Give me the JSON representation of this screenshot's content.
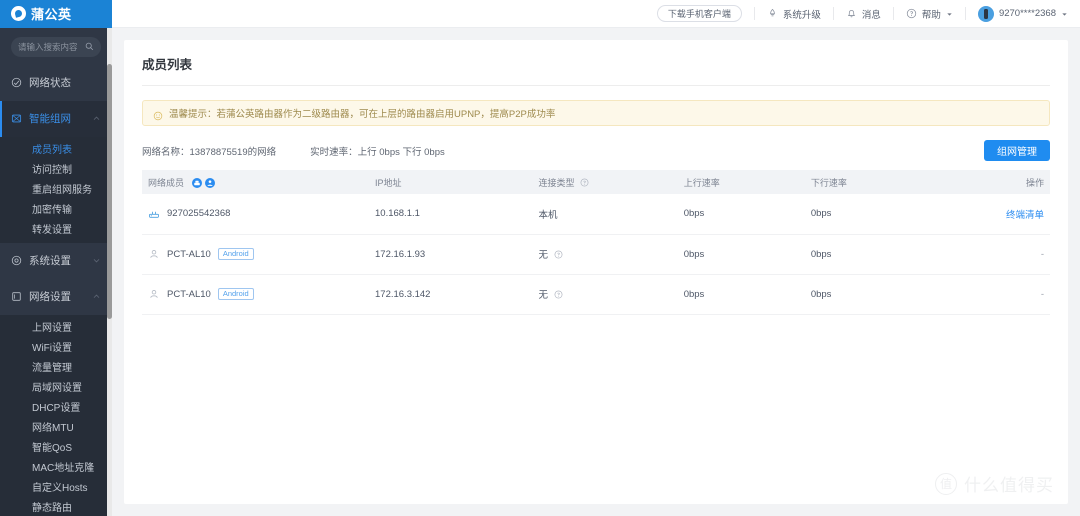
{
  "brand": {
    "name": "蒲公英",
    "logo_icon": "dandelion-logo-icon"
  },
  "sidebar": {
    "search_placeholder": "请输入搜索内容",
    "items": [
      {
        "label": "网络状态",
        "icon": "network-status-icon",
        "active": false,
        "expandable": false
      },
      {
        "label": "智能组网",
        "icon": "smart-network-icon",
        "active": true,
        "expandable": true,
        "caret": "chevron-up-icon"
      },
      {
        "label": "系统设置",
        "icon": "system-settings-icon",
        "active": false,
        "expandable": true,
        "caret": "chevron-down-icon"
      },
      {
        "label": "网络设置",
        "icon": "network-settings-icon",
        "active": false,
        "expandable": true,
        "caret": "chevron-up-icon"
      }
    ],
    "smart_network_sub": [
      {
        "label": "成员列表",
        "active": true
      },
      {
        "label": "访问控制",
        "active": false
      },
      {
        "label": "重启组网服务",
        "active": false
      },
      {
        "label": "加密传输",
        "active": false
      },
      {
        "label": "转发设置",
        "active": false
      }
    ],
    "network_settings_sub": [
      {
        "label": "上网设置",
        "active": false
      },
      {
        "label": "WiFi设置",
        "active": false
      },
      {
        "label": "流量管理",
        "active": false
      },
      {
        "label": "局域网设置",
        "active": false
      },
      {
        "label": "DHCP设置",
        "active": false
      },
      {
        "label": "网络MTU",
        "active": false
      },
      {
        "label": "智能QoS",
        "active": false
      },
      {
        "label": "MAC地址克隆",
        "active": false
      },
      {
        "label": "自定义Hosts",
        "active": false
      },
      {
        "label": "静态路由",
        "active": false
      }
    ]
  },
  "topbar": {
    "download_button": "下载手机客户端",
    "items": [
      {
        "label": "系统升级",
        "icon": "system-upgrade-icon",
        "has_caret": false
      },
      {
        "label": "消息",
        "icon": "bell-icon",
        "has_caret": false
      },
      {
        "label": "帮助",
        "icon": "question-circle-icon",
        "has_caret": true
      }
    ],
    "account": {
      "label": "9270****2368",
      "avatar_icon": "user-avatar-icon",
      "caret": "chevron-down-icon"
    }
  },
  "page": {
    "title": "成员列表",
    "notice": {
      "icon": "smiley-icon",
      "text": "温馨提示：若蒲公英路由器作为二级路由器，可在上层的路由器启用UPNP，提高P2P成功率"
    },
    "network_name_label": "网络名称：13878875519的网络",
    "realtime_speed_label": "实时速率：上行 0bps 下行 0bps",
    "manage_button": "组网管理"
  },
  "table": {
    "columns": [
      {
        "key": "member",
        "label": "网络成员",
        "badges": [
          "device-badge-icon",
          "person-badge-icon"
        ]
      },
      {
        "key": "ip",
        "label": "IP地址"
      },
      {
        "key": "type",
        "label": "连接类型",
        "help": "question-circle-icon"
      },
      {
        "key": "up",
        "label": "上行速率"
      },
      {
        "key": "down",
        "label": "下行速率"
      },
      {
        "key": "action",
        "label": "操作"
      }
    ],
    "rows": [
      {
        "icon": "router-icon",
        "member": "927025542368",
        "tag": "",
        "ip": "10.168.1.1",
        "type": "本机",
        "type_help": false,
        "up": "0bps",
        "down": "0bps",
        "action": "终端清单",
        "action_is_link": true
      },
      {
        "icon": "person-icon",
        "member": "PCT-AL10",
        "tag": "Android",
        "ip": "172.16.1.93",
        "type": "无",
        "type_help": true,
        "up": "0bps",
        "down": "0bps",
        "action": "-",
        "action_is_link": false
      },
      {
        "icon": "person-icon",
        "member": "PCT-AL10",
        "tag": "Android",
        "ip": "172.16.3.142",
        "type": "无",
        "type_help": true,
        "up": "0bps",
        "down": "0bps",
        "action": "-",
        "action_is_link": false
      }
    ]
  },
  "watermark": {
    "mark": "值",
    "text": "什么值得买"
  },
  "colors": {
    "brand_blue": "#1b83d5",
    "accent_blue": "#2b8cf0",
    "sidebar_bg": "#2f3745",
    "notice_bg": "#fdf8e9",
    "notice_text": "#9e8a4d"
  }
}
